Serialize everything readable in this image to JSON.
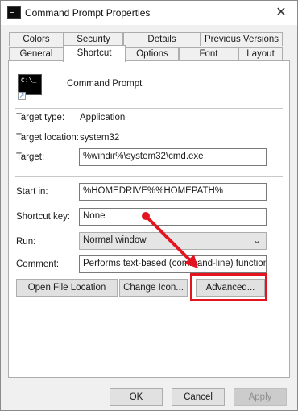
{
  "window": {
    "title": "Command Prompt Properties",
    "close_glyph": "✕"
  },
  "tabs": {
    "back_row": [
      "Colors",
      "Security",
      "Details",
      "Previous Versions"
    ],
    "front_row": [
      "General",
      "Shortcut",
      "Options",
      "Font",
      "Layout"
    ],
    "active": "Shortcut"
  },
  "shortcut": {
    "icon_prompt": "C:\\_",
    "name": "Command Prompt",
    "target_type_label": "Target type:",
    "target_type_value": "Application",
    "target_location_label": "Target location:",
    "target_location_value": "system32",
    "target_label": "Target:",
    "target_value": "%windir%\\system32\\cmd.exe",
    "start_in_label": "Start in:",
    "start_in_value": "%HOMEDRIVE%%HOMEPATH%",
    "shortcut_key_label": "Shortcut key:",
    "shortcut_key_value": "None",
    "run_label": "Run:",
    "run_value": "Normal window",
    "comment_label": "Comment:",
    "comment_value": "Performs text-based (command-line) functions.",
    "open_file_location": "Open File Location",
    "change_icon": "Change Icon...",
    "advanced": "Advanced..."
  },
  "footer": {
    "ok": "OK",
    "cancel": "Cancel",
    "apply": "Apply"
  },
  "colors": {
    "annotation_red": "#e3141f"
  },
  "icons": {
    "window": "cmd-icon",
    "close": "close-icon",
    "dropdown": "chevron-down-icon",
    "shortcut_overlay": "shortcut-arrow-icon"
  }
}
